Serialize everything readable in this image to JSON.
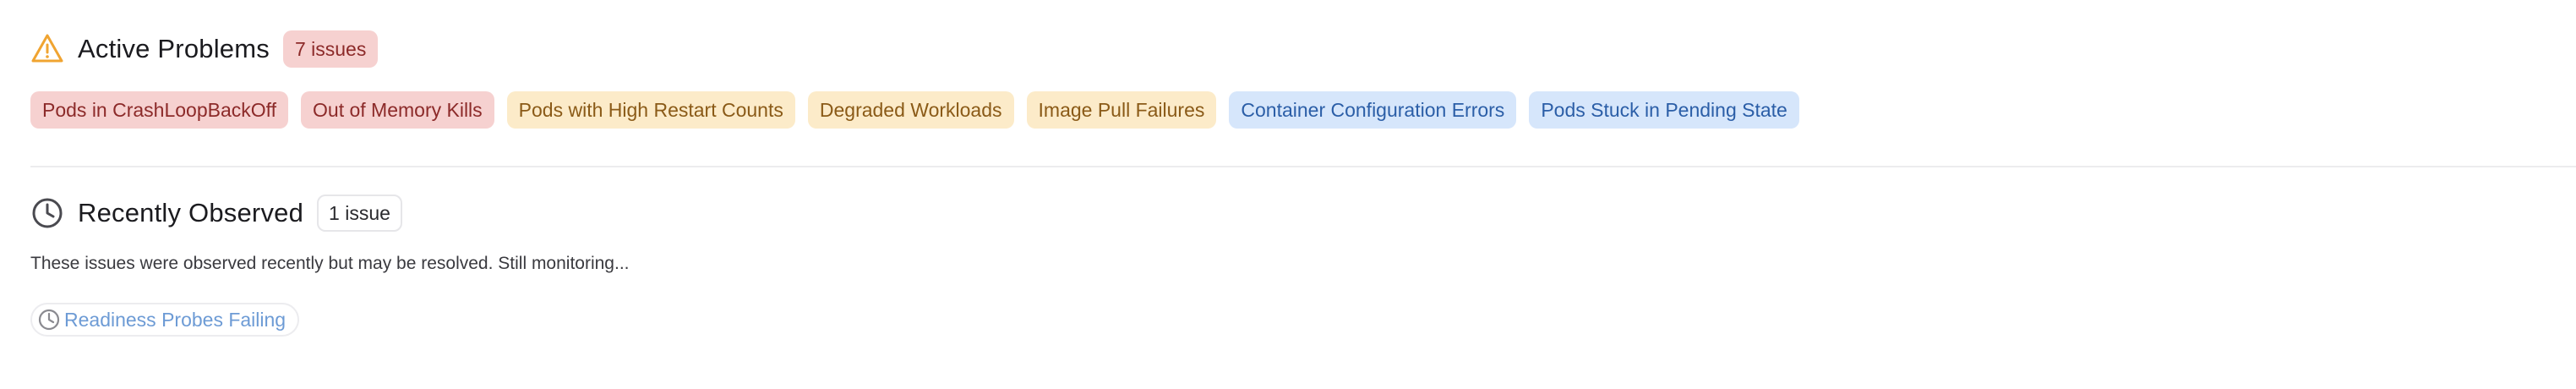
{
  "active": {
    "title": "Active Problems",
    "count_label": "7 issues",
    "icon": "warning-triangle-icon",
    "issues": [
      {
        "label": "Pods in CrashLoopBackOff",
        "severity": "critical",
        "color": "#f6d1d0"
      },
      {
        "label": "Out of Memory Kills",
        "severity": "critical",
        "color": "#f6d1d0"
      },
      {
        "label": "Pods with High Restart Counts",
        "severity": "warning",
        "color": "#fcebc9"
      },
      {
        "label": "Degraded Workloads",
        "severity": "warning",
        "color": "#fcebc9"
      },
      {
        "label": "Image Pull Failures",
        "severity": "warning",
        "color": "#fcebc9"
      },
      {
        "label": "Container Configuration Errors",
        "severity": "info",
        "color": "#d6e6fb"
      },
      {
        "label": "Pods Stuck in Pending State",
        "severity": "info",
        "color": "#d6e6fb"
      }
    ]
  },
  "recent": {
    "title": "Recently Observed",
    "count_label": "1 issue",
    "icon": "clock-icon",
    "description": "These issues were observed recently but may be resolved. Still monitoring...",
    "issues": [
      {
        "label": "Readiness Probes Failing",
        "icon": "clock-icon"
      }
    ]
  },
  "colors": {
    "warning_icon": "#f0a431",
    "critical_text": "#8c2a29",
    "warning_text": "#8a5a17",
    "info_text": "#2b5ea7",
    "recent_text": "#6d9bd5"
  }
}
